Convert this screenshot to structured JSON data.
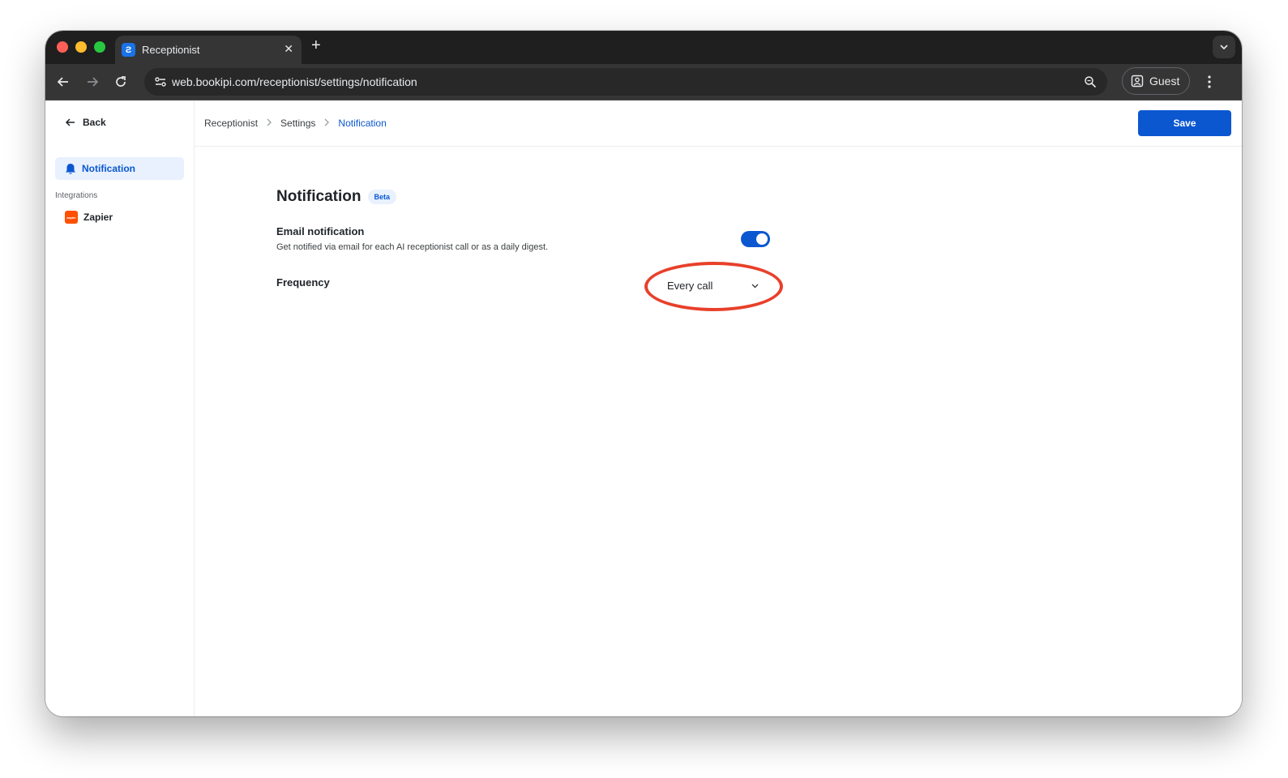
{
  "browser": {
    "tab_title": "Receptionist",
    "favicon_glyph": "Ƨ",
    "url": "web.bookipi.com/receptionist/settings/notification",
    "profile_label": "Guest"
  },
  "sidebar": {
    "back_label": "Back",
    "active_item": {
      "label": "Notification",
      "icon": "bell-icon"
    },
    "section_label": "Integrations",
    "items": [
      {
        "label": "Zapier",
        "icon": "zapier-icon",
        "icon_text": "zapier"
      }
    ]
  },
  "header": {
    "breadcrumb": [
      "Receptionist",
      "Settings",
      "Notification"
    ],
    "save_label": "Save"
  },
  "main": {
    "title": "Notification",
    "badge": "Beta",
    "email": {
      "title": "Email notification",
      "description": "Get notified via email for each AI receptionist call or as a daily digest.",
      "enabled": true
    },
    "frequency": {
      "label": "Frequency",
      "value": "Every call"
    }
  },
  "colors": {
    "accent": "#0b57d0",
    "highlight": "#e8402a"
  }
}
